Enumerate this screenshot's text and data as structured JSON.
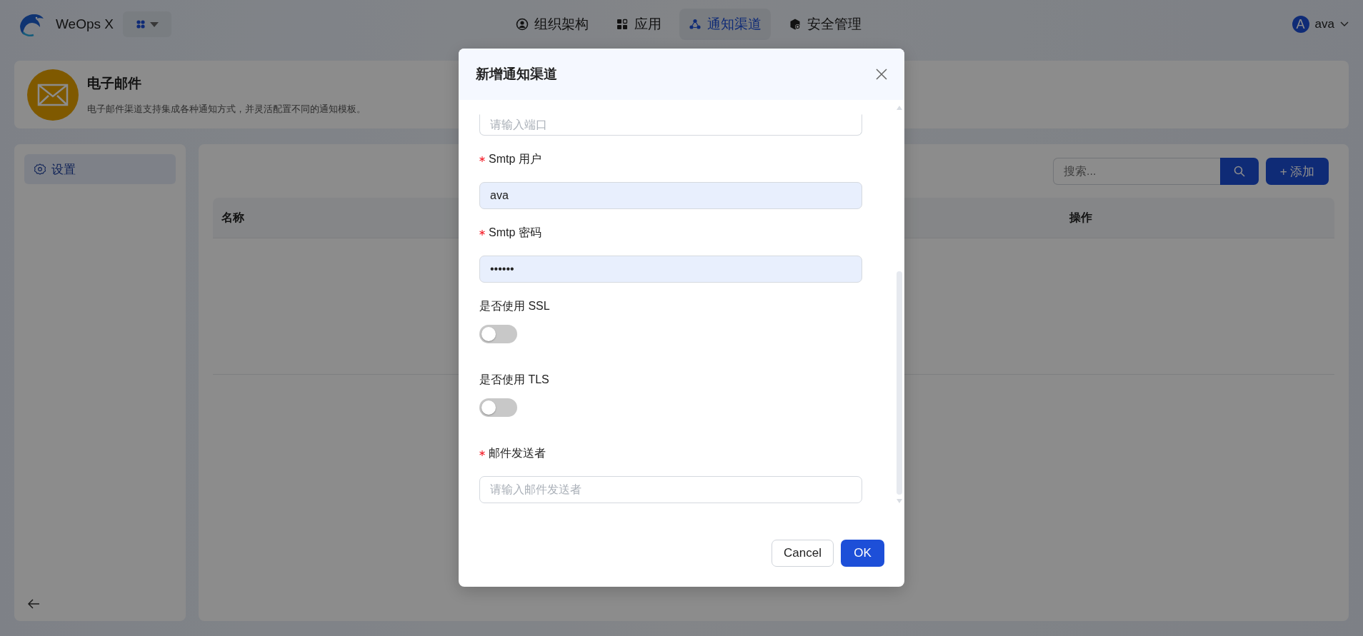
{
  "app": {
    "name": "WeOps X"
  },
  "nav": [
    {
      "label": "组织架构",
      "selected": false
    },
    {
      "label": "应用",
      "selected": false
    },
    {
      "label": "通知渠道",
      "selected": true
    },
    {
      "label": "安全管理",
      "selected": false
    }
  ],
  "user": {
    "initial": "A",
    "name": "ava"
  },
  "header": {
    "title": "电子邮件",
    "description": "电子邮件渠道支持集成各种通知方式，并灵活配置不同的通知模板。"
  },
  "sidebar": {
    "items": [
      {
        "label": "设置",
        "selected": true
      }
    ]
  },
  "toolbar": {
    "search": {
      "placeholder": "搜索..."
    },
    "add_button": "+ 添加"
  },
  "table": {
    "columns": [
      "名称",
      "操作"
    ]
  },
  "dialog": {
    "title": "新增通知渠道",
    "fields": [
      {
        "kind": "input",
        "placeholder": "请输入端口"
      },
      {
        "kind": "input",
        "label": "Smtp 用户",
        "required": true,
        "value": "ava"
      },
      {
        "kind": "input",
        "label": "Smtp 密码",
        "required": true,
        "value": "••••••"
      },
      {
        "kind": "switch",
        "label": "是否使用 SSL",
        "required": false,
        "on": false
      },
      {
        "kind": "switch",
        "label": "是否使用 TLS",
        "required": false,
        "on": false
      },
      {
        "kind": "input",
        "label": "邮件发送者",
        "required": true,
        "placeholder": "请输入邮件发送者"
      }
    ],
    "buttons": {
      "cancel": "Cancel",
      "ok": "OK"
    }
  }
}
